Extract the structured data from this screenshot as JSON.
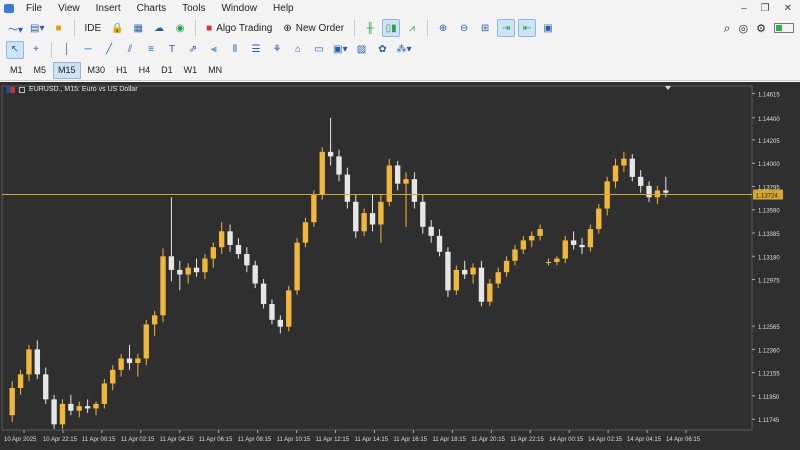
{
  "menu": [
    "File",
    "View",
    "Insert",
    "Charts",
    "Tools",
    "Window",
    "Help"
  ],
  "window_controls": {
    "minimize": "–",
    "restore": "❐",
    "close": "✕"
  },
  "toolbar": {
    "ide_label": "IDE",
    "algo_trading_label": "Algo Trading",
    "new_order_label": "New Order"
  },
  "timeframes": [
    "M1",
    "M5",
    "M15",
    "M30",
    "H1",
    "H4",
    "D1",
    "W1",
    "MN"
  ],
  "active_timeframe": "M15",
  "chart": {
    "symbol_label": "EURUSD., M15:  Euro vs US Dollar",
    "current_price": "1.13724",
    "price_ticks": [
      "1.14615",
      "1.14400",
      "1.14205",
      "1.14000",
      "1.13795",
      "1.13590",
      "1.13385",
      "1.13180",
      "1.12975",
      "1.12565",
      "1.12360",
      "1.12155",
      "1.11950",
      "1.11745"
    ],
    "time_ticks": [
      "10 Apr 2025",
      "10 Apr 22:15",
      "11 Apr 00:15",
      "11 Apr 02:15",
      "11 Apr 04:15",
      "11 Apr 06:15",
      "11 Apr 08:15",
      "11 Apr 10:15",
      "11 Apr 12:15",
      "11 Apr 14:15",
      "11 Apr 16:15",
      "11 Apr 18:15",
      "11 Apr 20:15",
      "11 Apr 22:15",
      "14 Apr 00:15",
      "14 Apr 02:15",
      "14 Apr 04:15",
      "14 Apr 06:15"
    ],
    "colors": {
      "background": "#2f2f2f",
      "bull": "#f0b73a",
      "bear": "#e6e6e6",
      "price_line": "#d4a72c",
      "axis_text": "#dddddd"
    }
  },
  "chart_data": {
    "type": "candlestick",
    "ylim": [
      1.1165,
      1.1468
    ],
    "candles": [
      [
        1.1178,
        1.1208,
        1.1172,
        1.1202
      ],
      [
        1.1202,
        1.1218,
        1.1196,
        1.1214
      ],
      [
        1.1214,
        1.124,
        1.1208,
        1.1236
      ],
      [
        1.1236,
        1.1244,
        1.121,
        1.1214
      ],
      [
        1.1214,
        1.122,
        1.1188,
        1.1192
      ],
      [
        1.1192,
        1.1196,
        1.1166,
        1.117
      ],
      [
        1.117,
        1.1192,
        1.1166,
        1.1188
      ],
      [
        1.1188,
        1.1196,
        1.1178,
        1.1182
      ],
      [
        1.1182,
        1.119,
        1.1176,
        1.1186
      ],
      [
        1.1186,
        1.1192,
        1.118,
        1.1184
      ],
      [
        1.1184,
        1.119,
        1.1178,
        1.1188
      ],
      [
        1.1188,
        1.121,
        1.1184,
        1.1206
      ],
      [
        1.1206,
        1.1222,
        1.12,
        1.1218
      ],
      [
        1.1218,
        1.1232,
        1.1212,
        1.1228
      ],
      [
        1.1228,
        1.124,
        1.1218,
        1.1224
      ],
      [
        1.1224,
        1.1232,
        1.1212,
        1.1228
      ],
      [
        1.1228,
        1.1262,
        1.1222,
        1.1258
      ],
      [
        1.1258,
        1.127,
        1.1248,
        1.1266
      ],
      [
        1.1266,
        1.1325,
        1.126,
        1.1318
      ],
      [
        1.1318,
        1.137,
        1.1296,
        1.1306
      ],
      [
        1.1306,
        1.1314,
        1.1288,
        1.1302
      ],
      [
        1.1302,
        1.1312,
        1.1294,
        1.1308
      ],
      [
        1.1308,
        1.1316,
        1.13,
        1.1304
      ],
      [
        1.1304,
        1.132,
        1.1298,
        1.1316
      ],
      [
        1.1316,
        1.133,
        1.1308,
        1.1326
      ],
      [
        1.1326,
        1.1348,
        1.132,
        1.134
      ],
      [
        1.134,
        1.1346,
        1.1322,
        1.1328
      ],
      [
        1.1328,
        1.1334,
        1.1316,
        1.132
      ],
      [
        1.132,
        1.1326,
        1.1304,
        1.131
      ],
      [
        1.131,
        1.1314,
        1.129,
        1.1294
      ],
      [
        1.1294,
        1.1298,
        1.1272,
        1.1276
      ],
      [
        1.1276,
        1.128,
        1.1258,
        1.1262
      ],
      [
        1.1262,
        1.1266,
        1.125,
        1.1256
      ],
      [
        1.1256,
        1.1292,
        1.1252,
        1.1288
      ],
      [
        1.1288,
        1.1334,
        1.1284,
        1.133
      ],
      [
        1.133,
        1.1352,
        1.1326,
        1.1348
      ],
      [
        1.1348,
        1.1376,
        1.1344,
        1.1372
      ],
      [
        1.1372,
        1.1414,
        1.1368,
        1.141
      ],
      [
        1.141,
        1.144,
        1.1398,
        1.1406
      ],
      [
        1.1406,
        1.1412,
        1.1384,
        1.139
      ],
      [
        1.139,
        1.1396,
        1.136,
        1.1366
      ],
      [
        1.1366,
        1.1372,
        1.1334,
        1.134
      ],
      [
        1.134,
        1.136,
        1.1336,
        1.1356
      ],
      [
        1.1356,
        1.1372,
        1.134,
        1.1346
      ],
      [
        1.1346,
        1.1372,
        1.133,
        1.1366
      ],
      [
        1.1366,
        1.1404,
        1.1362,
        1.1398
      ],
      [
        1.1398,
        1.1402,
        1.1376,
        1.1382
      ],
      [
        1.1382,
        1.1392,
        1.1344,
        1.1386
      ],
      [
        1.1386,
        1.1392,
        1.136,
        1.1366
      ],
      [
        1.1366,
        1.1372,
        1.1338,
        1.1344
      ],
      [
        1.1344,
        1.135,
        1.133,
        1.1336
      ],
      [
        1.1336,
        1.1342,
        1.1318,
        1.1322
      ],
      [
        1.1322,
        1.1326,
        1.1282,
        1.1288
      ],
      [
        1.1288,
        1.131,
        1.1284,
        1.1306
      ],
      [
        1.1306,
        1.1314,
        1.1298,
        1.1302
      ],
      [
        1.1302,
        1.1312,
        1.1294,
        1.1308
      ],
      [
        1.1308,
        1.1314,
        1.1274,
        1.1278
      ],
      [
        1.1278,
        1.1298,
        1.1274,
        1.1294
      ],
      [
        1.1294,
        1.1308,
        1.129,
        1.1304
      ],
      [
        1.1304,
        1.1318,
        1.13,
        1.1314
      ],
      [
        1.1314,
        1.1328,
        1.131,
        1.1324
      ],
      [
        1.1324,
        1.1336,
        1.132,
        1.1332
      ],
      [
        1.1332,
        1.134,
        1.1326,
        1.1336
      ],
      [
        1.1336,
        1.1346,
        1.1332,
        1.1342
      ],
      [
        1.1312,
        1.1316,
        1.131,
        1.1313
      ],
      [
        1.1313,
        1.1318,
        1.131,
        1.1316
      ],
      [
        1.1316,
        1.1336,
        1.1312,
        1.1332
      ],
      [
        1.1332,
        1.134,
        1.1324,
        1.1328
      ],
      [
        1.1328,
        1.1334,
        1.132,
        1.1326
      ],
      [
        1.1326,
        1.1346,
        1.1322,
        1.1342
      ],
      [
        1.1342,
        1.1364,
        1.1338,
        1.136
      ],
      [
        1.136,
        1.1388,
        1.1354,
        1.1384
      ],
      [
        1.1384,
        1.1404,
        1.1378,
        1.1398
      ],
      [
        1.1398,
        1.141,
        1.1392,
        1.1404
      ],
      [
        1.1404,
        1.1408,
        1.1384,
        1.1388
      ],
      [
        1.1388,
        1.1394,
        1.1374,
        1.138
      ],
      [
        1.138,
        1.1384,
        1.1366,
        1.137
      ],
      [
        1.137,
        1.138,
        1.1364,
        1.1376
      ],
      [
        1.1376,
        1.1388,
        1.137,
        1.1374
      ]
    ]
  }
}
